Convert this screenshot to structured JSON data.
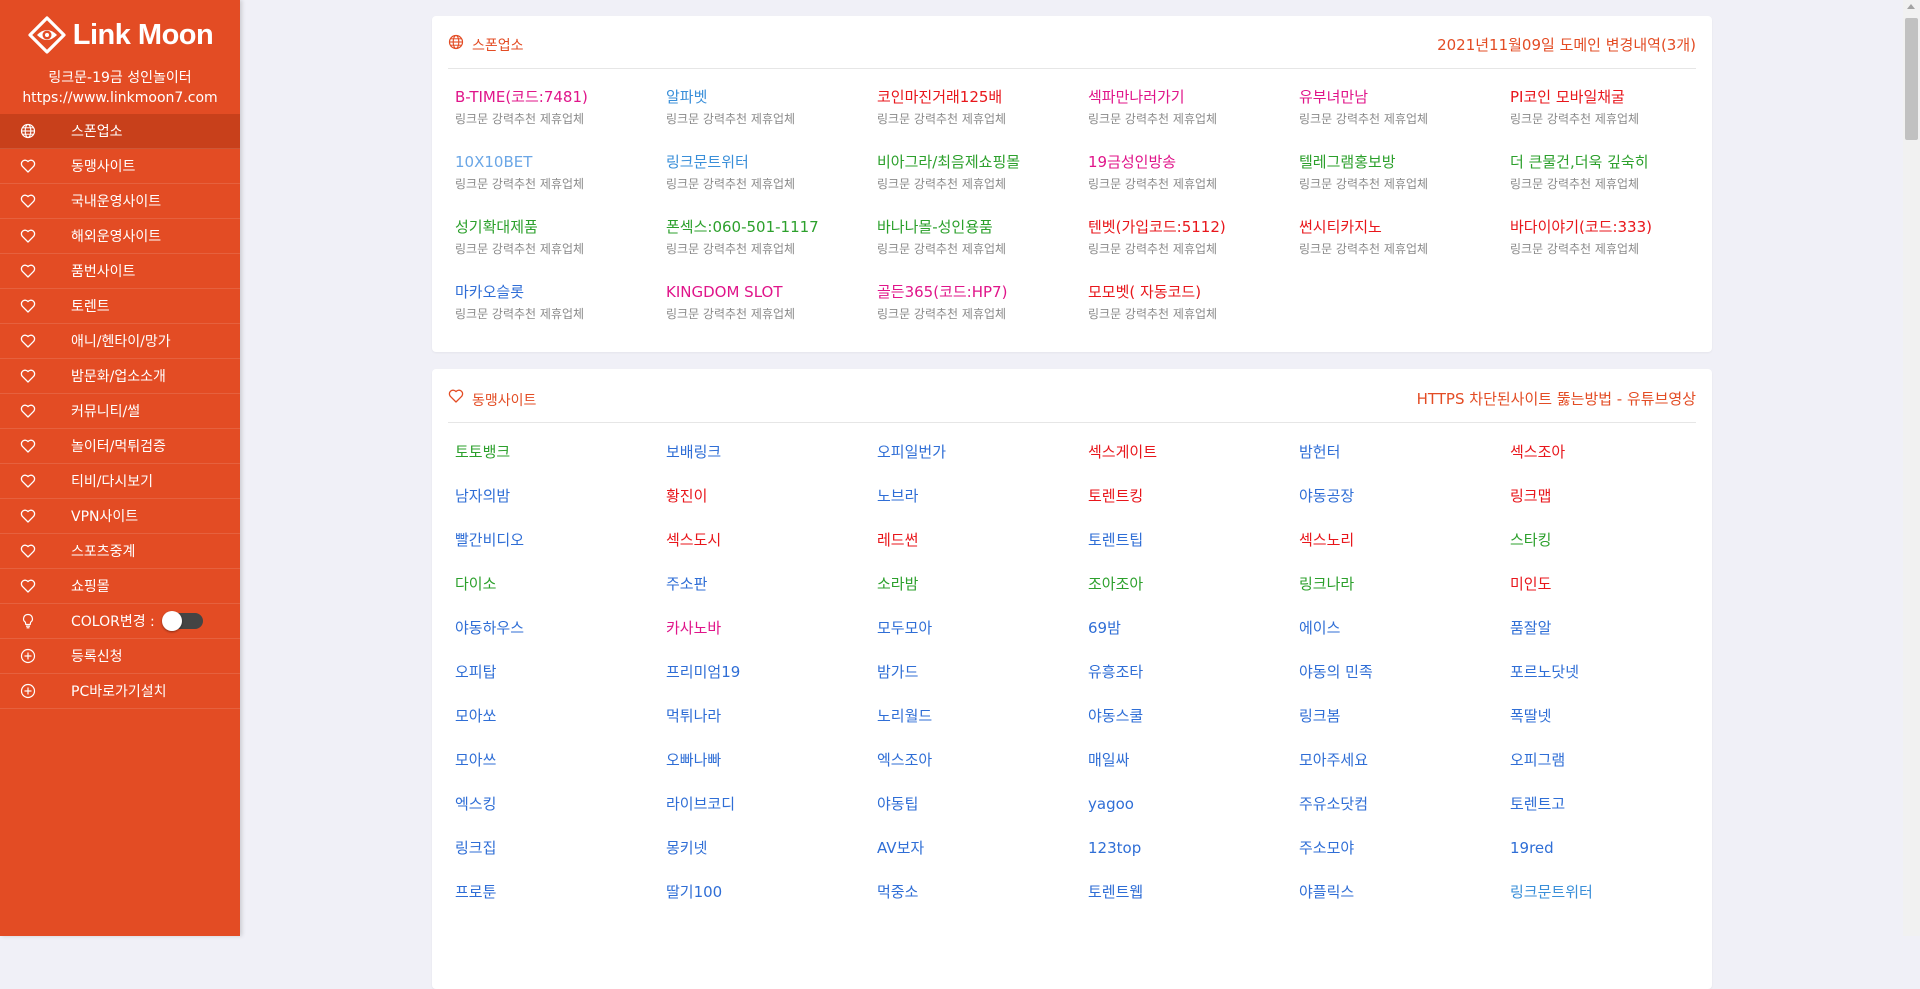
{
  "sidebar": {
    "brand": "Link Moon",
    "tagline": "링크문-19금 성인놀이터",
    "url": "https://www.linkmoon7.com",
    "items": [
      {
        "label": "스폰업소",
        "icon": "globe-icon",
        "active": true
      },
      {
        "label": "동맹사이트",
        "icon": "heart-icon"
      },
      {
        "label": "국내운영사이트",
        "icon": "heart-icon"
      },
      {
        "label": "해외운영사이트",
        "icon": "heart-icon"
      },
      {
        "label": "품번사이트",
        "icon": "heart-icon"
      },
      {
        "label": "토렌트",
        "icon": "heart-icon"
      },
      {
        "label": "애니/헨타이/망가",
        "icon": "heart-icon"
      },
      {
        "label": "밤문화/업소소개",
        "icon": "heart-icon"
      },
      {
        "label": "커뮤니티/썰",
        "icon": "heart-icon"
      },
      {
        "label": "놀이터/먹튀검증",
        "icon": "heart-icon"
      },
      {
        "label": "티비/다시보기",
        "icon": "heart-icon"
      },
      {
        "label": "VPN사이트",
        "icon": "heart-icon"
      },
      {
        "label": "스포츠중계",
        "icon": "heart-icon"
      },
      {
        "label": "쇼핑몰",
        "icon": "heart-icon"
      },
      {
        "label": "COLOR변경 :",
        "icon": "bulb-icon",
        "toggle": true
      },
      {
        "label": "등록신청",
        "icon": "plus-circle-icon"
      },
      {
        "label": "PC바로가기설치",
        "icon": "plus-circle-icon"
      }
    ]
  },
  "colors": {
    "accent": "#e34c24",
    "green": "#2ca02c",
    "blue": "#2f6ed6",
    "red": "#e8161b",
    "pink": "#e0158a",
    "lightblue": "#6aa6e6",
    "cyan": "#3a8fd9"
  },
  "sponsor": {
    "title": "스폰업소",
    "link": "2021년11월09일 도메인 변경내역(3개)",
    "items": [
      {
        "name": "B-TIME(코드:7481)",
        "color": "pink",
        "sub": "링크문 강력추천 제휴업체"
      },
      {
        "name": "알파벳",
        "color": "cyan",
        "sub": "링크문 강력추천 제휴업체"
      },
      {
        "name": "코인마진거래125배",
        "color": "red",
        "sub": "링크문 강력추천 제휴업체"
      },
      {
        "name": "섹파만나러가기",
        "color": "pink",
        "sub": "링크문 강력추천 제휴업체"
      },
      {
        "name": "유부녀만남",
        "color": "pink",
        "sub": "링크문 강력추천 제휴업체"
      },
      {
        "name": "PI코인 모바일채굴",
        "color": "red",
        "sub": "링크문 강력추천 제휴업체"
      },
      {
        "name": "10X10BET",
        "color": "lightblue",
        "sub": "링크문 강력추천 제휴업체"
      },
      {
        "name": "링크문트위터",
        "color": "cyan",
        "sub": "링크문 강력추천 제휴업체"
      },
      {
        "name": "비아그라/최음제쇼핑몰",
        "color": "green",
        "sub": "링크문 강력추천 제휴업체"
      },
      {
        "name": "19금성인방송",
        "color": "pink",
        "sub": "링크문 강력추천 제휴업체"
      },
      {
        "name": "텔레그램홍보방",
        "color": "green",
        "sub": "링크문 강력추천 제휴업체"
      },
      {
        "name": "더 큰물건,더욱 깊숙히",
        "color": "green",
        "sub": "링크문 강력추천 제휴업체"
      },
      {
        "name": "성기확대제품",
        "color": "green",
        "sub": "링크문 강력추천 제휴업체"
      },
      {
        "name": "폰섹스:060-501-1117",
        "color": "green",
        "sub": "링크문 강력추천 제휴업체"
      },
      {
        "name": "바나나몰-성인용품",
        "color": "green",
        "sub": "링크문 강력추천 제휴업체"
      },
      {
        "name": "텐벳(가입코드:5112)",
        "color": "red",
        "sub": "링크문 강력추천 제휴업체"
      },
      {
        "name": "썬시티카지노",
        "color": "red",
        "sub": "링크문 강력추천 제휴업체"
      },
      {
        "name": "바다이야기(코드:333)",
        "color": "red",
        "sub": "링크문 강력추천 제휴업체"
      },
      {
        "name": "마카오슬롯",
        "color": "blue",
        "sub": "링크문 강력추천 제휴업체"
      },
      {
        "name": "KINGDOM SLOT",
        "color": "pink",
        "sub": "링크문 강력추천 제휴업체"
      },
      {
        "name": "골든365(코드:HP7)",
        "color": "pink",
        "sub": "링크문 강력추천 제휴업체"
      },
      {
        "name": "모모벳( 자동코드)",
        "color": "red",
        "sub": "링크문 강력추천 제휴업체"
      }
    ]
  },
  "alliance": {
    "title": "동맹사이트",
    "link": "HTTPS 차단된사이트 뚫는방법 - 유튜브영상",
    "items": [
      {
        "name": "토토뱅크",
        "color": "green"
      },
      {
        "name": "보배링크",
        "color": "blue"
      },
      {
        "name": "오피일번가",
        "color": "blue"
      },
      {
        "name": "섹스게이트",
        "color": "red"
      },
      {
        "name": "밤헌터",
        "color": "blue"
      },
      {
        "name": "섹스조아",
        "color": "red"
      },
      {
        "name": "남자의밤",
        "color": "blue"
      },
      {
        "name": "황진이",
        "color": "red"
      },
      {
        "name": "노브라",
        "color": "blue"
      },
      {
        "name": "토렌트킹",
        "color": "red"
      },
      {
        "name": "야동공장",
        "color": "blue"
      },
      {
        "name": "링크맵",
        "color": "red"
      },
      {
        "name": "빨간비디오",
        "color": "blue"
      },
      {
        "name": "섹스도시",
        "color": "red"
      },
      {
        "name": "레드썬",
        "color": "red"
      },
      {
        "name": "토렌트팁",
        "color": "blue"
      },
      {
        "name": "섹스노리",
        "color": "red"
      },
      {
        "name": "스타킹",
        "color": "green"
      },
      {
        "name": "다이소",
        "color": "green"
      },
      {
        "name": "주소판",
        "color": "blue"
      },
      {
        "name": "소라밤",
        "color": "green"
      },
      {
        "name": "조아조아",
        "color": "green"
      },
      {
        "name": "링크나라",
        "color": "green"
      },
      {
        "name": "미인도",
        "color": "red"
      },
      {
        "name": "야동하우스",
        "color": "blue"
      },
      {
        "name": "카사노바",
        "color": "pink"
      },
      {
        "name": "모두모아",
        "color": "blue"
      },
      {
        "name": "69밤",
        "color": "blue"
      },
      {
        "name": "에이스",
        "color": "blue"
      },
      {
        "name": "품잘알",
        "color": "blue"
      },
      {
        "name": "오피탑",
        "color": "blue"
      },
      {
        "name": "프리미엄19",
        "color": "blue"
      },
      {
        "name": "밤가드",
        "color": "blue"
      },
      {
        "name": "유흥조타",
        "color": "blue"
      },
      {
        "name": "야동의 민족",
        "color": "blue"
      },
      {
        "name": "포르노닷넷",
        "color": "blue"
      },
      {
        "name": "모아쏘",
        "color": "blue"
      },
      {
        "name": "먹튀나라",
        "color": "blue"
      },
      {
        "name": "노리월드",
        "color": "blue"
      },
      {
        "name": "야동스쿨",
        "color": "blue"
      },
      {
        "name": "링크봄",
        "color": "blue"
      },
      {
        "name": "폭딸넷",
        "color": "blue"
      },
      {
        "name": "모아쓰",
        "color": "blue"
      },
      {
        "name": "오빠나빠",
        "color": "blue"
      },
      {
        "name": "엑스조아",
        "color": "blue"
      },
      {
        "name": "매일싸",
        "color": "blue"
      },
      {
        "name": "모아주세요",
        "color": "blue"
      },
      {
        "name": "오피그램",
        "color": "blue"
      },
      {
        "name": "엑스킹",
        "color": "blue"
      },
      {
        "name": "라이브코디",
        "color": "blue"
      },
      {
        "name": "야동팁",
        "color": "blue"
      },
      {
        "name": "yagoo",
        "color": "blue"
      },
      {
        "name": "주유소닷컴",
        "color": "blue"
      },
      {
        "name": "토렌트고",
        "color": "blue"
      },
      {
        "name": "링크집",
        "color": "blue"
      },
      {
        "name": "몽키넷",
        "color": "blue"
      },
      {
        "name": "AV보자",
        "color": "blue"
      },
      {
        "name": "123top",
        "color": "blue"
      },
      {
        "name": "주소모야",
        "color": "blue"
      },
      {
        "name": "19red",
        "color": "blue"
      },
      {
        "name": "프로툰",
        "color": "blue"
      },
      {
        "name": "딸기100",
        "color": "blue"
      },
      {
        "name": "먹중소",
        "color": "blue"
      },
      {
        "name": "토렌트웹",
        "color": "blue"
      },
      {
        "name": "야플릭스",
        "color": "blue"
      },
      {
        "name": "링크문트위터",
        "color": "cyan"
      }
    ]
  }
}
